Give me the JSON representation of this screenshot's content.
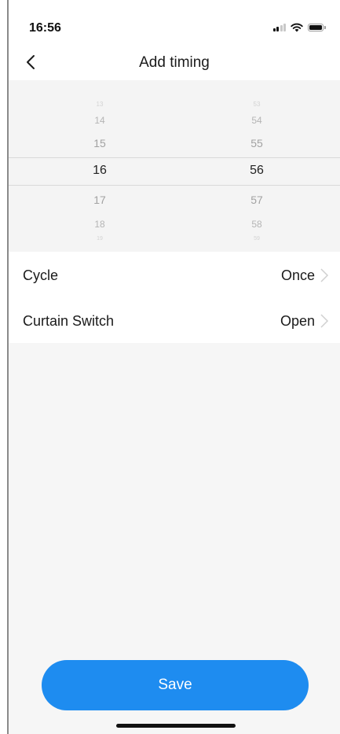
{
  "status_bar": {
    "time": "16:56",
    "icons": [
      "signal-icon",
      "wifi-icon",
      "battery-icon"
    ]
  },
  "nav": {
    "title": "Add timing",
    "back_icon": "chevron-left-icon"
  },
  "picker": {
    "hours": [
      "13",
      "14",
      "15",
      "16",
      "17",
      "18",
      "19"
    ],
    "minutes": [
      "53",
      "54",
      "55",
      "56",
      "57",
      "58",
      "59"
    ],
    "selected_hour": "16",
    "selected_minute": "56"
  },
  "settings": [
    {
      "label": "Cycle",
      "value": "Once"
    },
    {
      "label": "Curtain Switch",
      "value": "Open"
    }
  ],
  "save_label": "Save",
  "colors": {
    "accent": "#1e8cf0",
    "background": "#f6f6f6"
  }
}
